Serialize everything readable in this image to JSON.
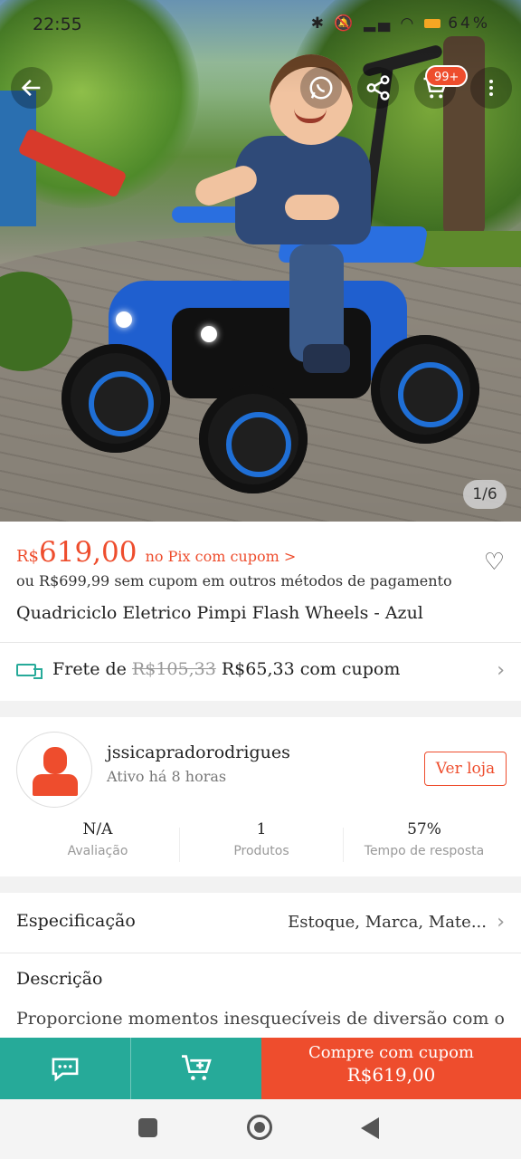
{
  "status_bar": {
    "time": "22:55",
    "battery": "64%"
  },
  "hero": {
    "image_counter": "1/6",
    "cart_badge": "99+"
  },
  "price": {
    "currency": "R$",
    "value": "619,00",
    "note": "no Pix com cupom >",
    "alt_text": "ou R$699,99 sem cupom em outros métodos de pagamento"
  },
  "product": {
    "title": "Quadriciclo Eletrico Pimpi Flash Wheels - Azul"
  },
  "shipping": {
    "prefix": "Frete de",
    "old_price": "R$105,33",
    "new_text": "R$65,33 com cupom"
  },
  "seller": {
    "name": "jssicapradorodrigues",
    "active": "Ativo há 8 horas",
    "visit_label": "Ver loja",
    "stats": [
      {
        "value": "N/A",
        "label": "Avaliação"
      },
      {
        "value": "1",
        "label": "Produtos"
      },
      {
        "value": "57%",
        "label": "Tempo de resposta"
      }
    ]
  },
  "spec": {
    "label": "Especificação",
    "value": "Estoque, Marca, Mate..."
  },
  "description": {
    "label": "Descrição",
    "text": "Proporcione momentos inesquecíveis de diversão com o"
  },
  "actions": {
    "buy_line1": "Compre com cupom",
    "buy_line2": "R$619,00"
  },
  "colors": {
    "accent": "#ee4d2d",
    "teal": "#26aa99"
  },
  "icons": [
    "back-arrow-icon",
    "whatsapp-icon",
    "share-icon",
    "cart-icon",
    "more-icon",
    "heart-icon",
    "truck-icon",
    "chevron-right-icon",
    "chat-icon",
    "add-to-cart-icon"
  ]
}
